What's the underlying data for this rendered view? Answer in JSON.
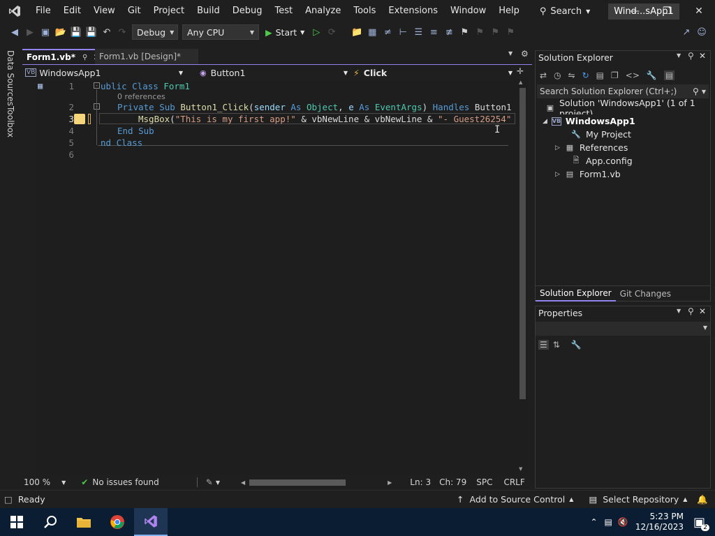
{
  "menubar": {
    "items": [
      "File",
      "Edit",
      "View",
      "Git",
      "Project",
      "Build",
      "Debug",
      "Test",
      "Analyze",
      "Tools",
      "Extensions",
      "Window",
      "Help"
    ],
    "search_label": "Search",
    "solution_title": "Wind...sApp1"
  },
  "toolbar": {
    "config": "Debug",
    "platform": "Any CPU",
    "start_label": "Start"
  },
  "left_tabs": [
    "Data Sources",
    "Toolbox"
  ],
  "editor": {
    "tabs": [
      {
        "label": "Form1.vb*",
        "active": true
      },
      {
        "label": "Form1.vb [Design]*",
        "active": false
      }
    ],
    "nav": {
      "project": "WindowsApp1",
      "object": "Button1",
      "event": "Click"
    },
    "line_numbers": [
      "1",
      "2",
      "3",
      "4",
      "5",
      "6"
    ],
    "codelens": "0 references",
    "code": {
      "line1_kw": "ublic Class",
      "line1_name": "Form1",
      "line2_kw1": "Private Sub",
      "line2_fn": "Button1_Click",
      "line2_p1": "sender",
      "line2_as1": "As",
      "line2_t1": "Object",
      "line2_p2": "e",
      "line2_as2": "As",
      "line2_t2": "EventArgs",
      "line2_handles": "Handles",
      "line2_tail": "Button1",
      "line3_fn": "MsgBox",
      "line3_str1": "\"This is my first app!\"",
      "line3_mid1": "& vbNewLine & vbNewLine &",
      "line3_str2": "\"- Guest26254\"",
      "line4": "End Sub",
      "line5": "nd Class"
    },
    "status": {
      "zoom": "100 %",
      "issues": "No issues found",
      "ln": "Ln: 3",
      "ch": "Ch: 79",
      "spc": "SPC",
      "crlf": "CRLF"
    }
  },
  "solution_explorer": {
    "title": "Solution Explorer",
    "search_placeholder": "Search Solution Explorer (Ctrl+;)",
    "solution": "Solution 'WindowsApp1' (1 of 1 project)",
    "project": "WindowsApp1",
    "items": [
      "My Project",
      "References",
      "App.config",
      "Form1.vb"
    ],
    "tabs": [
      "Solution Explorer",
      "Git Changes"
    ]
  },
  "properties": {
    "title": "Properties"
  },
  "statusbar": {
    "ready": "Ready",
    "source_control": "Add to Source Control",
    "repository": "Select Repository"
  },
  "taskbar": {
    "time": "5:23 PM",
    "date": "12/16/2023",
    "notifications": "2"
  },
  "colors": {
    "accent": "#9184ee",
    "bg": "#1f1f1f",
    "taskbar": "#0b1d33"
  }
}
